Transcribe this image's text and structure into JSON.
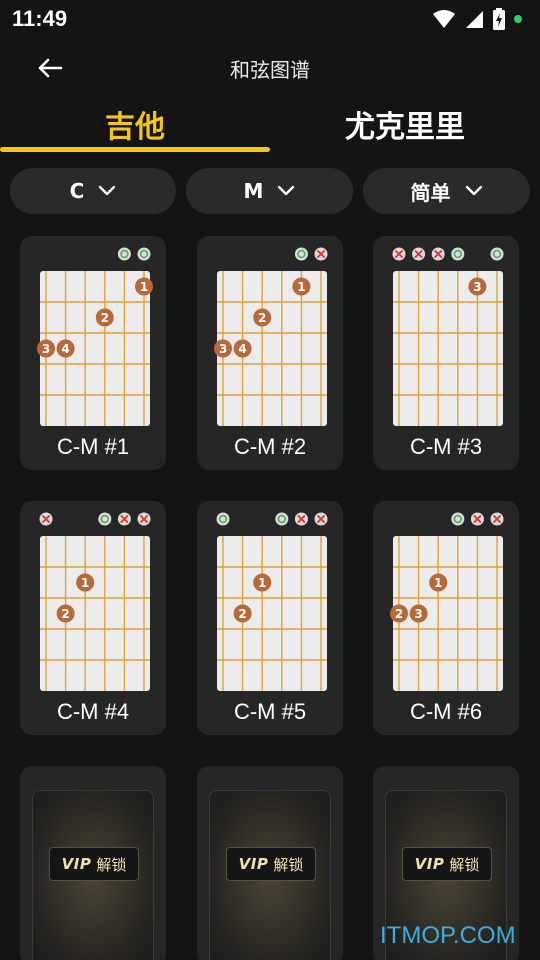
{
  "status": {
    "time": "11:49",
    "dot_color": "#2ecc71"
  },
  "app_bar": {
    "title": "和弦图谱"
  },
  "tabs": [
    {
      "label": "吉他",
      "active": true
    },
    {
      "label": "尤克里里",
      "active": false
    }
  ],
  "filters": [
    {
      "label": "C"
    },
    {
      "label": "M"
    },
    {
      "label": "简单"
    }
  ],
  "colors": {
    "accent": "#f5c518",
    "card": "#262626",
    "finger": "#b8693a",
    "string": "#e0a23a"
  },
  "chords": [
    {
      "label": "C-M #1",
      "open_strings": [
        "",
        "",
        "",
        "",
        "o",
        "o"
      ],
      "fingers": [
        {
          "string": 5,
          "fret": 1,
          "finger": "1"
        },
        {
          "string": 3,
          "fret": 2,
          "finger": "2"
        },
        {
          "string": 0,
          "fret": 3,
          "finger": "3"
        },
        {
          "string": 1,
          "fret": 3,
          "finger": "4"
        }
      ]
    },
    {
      "label": "C-M #2",
      "open_strings": [
        "",
        "",
        "",
        "",
        "o",
        "x"
      ],
      "fingers": [
        {
          "string": 4,
          "fret": 1,
          "finger": "1"
        },
        {
          "string": 2,
          "fret": 2,
          "finger": "2"
        },
        {
          "string": 0,
          "fret": 3,
          "finger": "3"
        },
        {
          "string": 1,
          "fret": 3,
          "finger": "4"
        }
      ]
    },
    {
      "label": "C-M #3",
      "open_strings": [
        "x",
        "x",
        "x",
        "o",
        "",
        "o"
      ],
      "fingers": [
        {
          "string": 4,
          "fret": 1,
          "finger": "3"
        }
      ]
    },
    {
      "label": "C-M #4",
      "open_strings": [
        "x",
        "",
        "",
        "o",
        "x",
        "x"
      ],
      "fingers": [
        {
          "string": 2,
          "fret": 2,
          "finger": "1"
        },
        {
          "string": 1,
          "fret": 3,
          "finger": "2"
        }
      ]
    },
    {
      "label": "C-M #5",
      "open_strings": [
        "o",
        "",
        "",
        "o",
        "x",
        "x"
      ],
      "fingers": [
        {
          "string": 2,
          "fret": 2,
          "finger": "1"
        },
        {
          "string": 1,
          "fret": 3,
          "finger": "2"
        }
      ]
    },
    {
      "label": "C-M #6",
      "open_strings": [
        "",
        "",
        "",
        "o",
        "x",
        "x"
      ],
      "fingers": [
        {
          "string": 2,
          "fret": 2,
          "finger": "1"
        },
        {
          "string": 0,
          "fret": 3,
          "finger": "2"
        },
        {
          "string": 1,
          "fret": 3,
          "finger": "3"
        }
      ]
    }
  ],
  "vip_cards": [
    {
      "badge": "VIP",
      "text": "解锁"
    },
    {
      "badge": "VIP",
      "text": "解锁"
    },
    {
      "badge": "VIP",
      "text": "解锁"
    }
  ],
  "watermark": "ITMOP.COM"
}
